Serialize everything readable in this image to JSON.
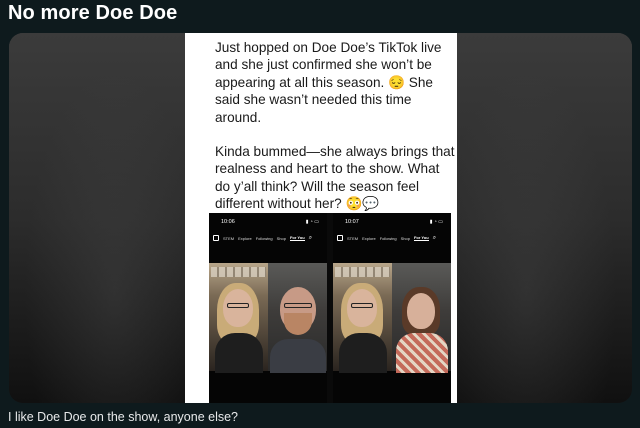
{
  "post": {
    "title": "No more Doe Doe",
    "caption": "I like Doe Doe on the show, anyone else?"
  },
  "image_text": {
    "paragraph1": "Just hopped on Doe Doe’s TikTok live and she just confirmed she won’t be appearing at all this season. 😔 She said she wasn’t needed this time around.",
    "paragraph2": "Kinda bummed—she always brings that realness and heart to the show. What do y’all think? Will the season feel different without her? 😳💬"
  },
  "screenshots": [
    {
      "time": "10:06",
      "nav": [
        "STEM",
        "Explore",
        "Following",
        "Shop",
        "For You"
      ],
      "active_tab": "For You"
    },
    {
      "time": "10:07",
      "nav": [
        "STEM",
        "Explore",
        "Following",
        "Shop",
        "For You"
      ],
      "active_tab": "For You"
    }
  ],
  "colors": {
    "background": "#0e1a1d",
    "text": "#e7e9ea"
  }
}
